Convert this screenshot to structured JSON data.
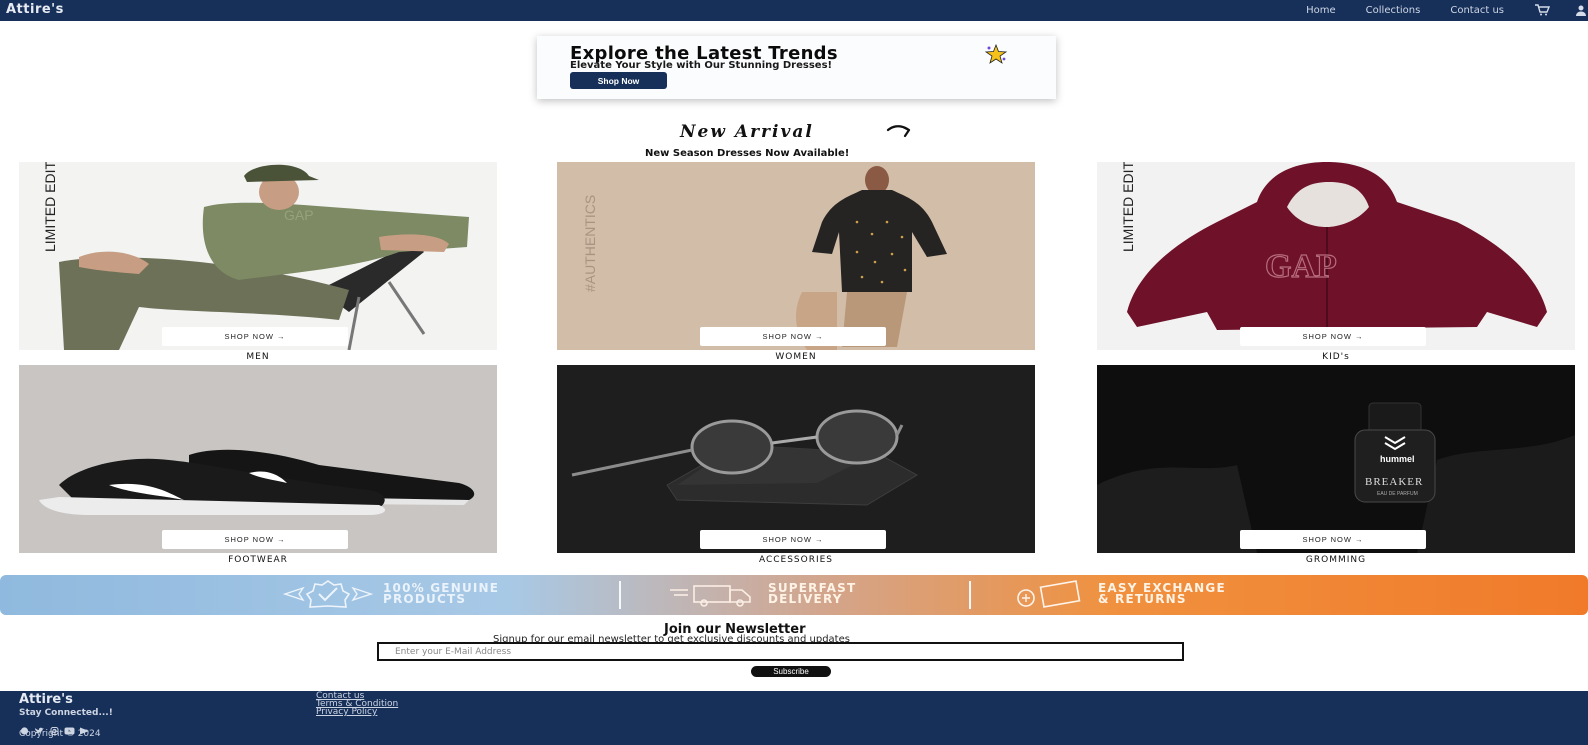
{
  "nav": {
    "brand": "Attire's",
    "links": [
      "Home",
      "Collections",
      "Contact us"
    ],
    "icons": [
      "cart-icon",
      "user-icon"
    ]
  },
  "hero": {
    "title": "Explore the Latest Trends",
    "subtitle": "Elevate Your Style with Our Stunning Dresses!",
    "button": "Shop Now"
  },
  "new_arrival": {
    "title": "New Arrival",
    "subtitle": "New Season Dresses Now Available!"
  },
  "categories": [
    {
      "label": "MEN",
      "button": "SHOP NOW →",
      "side_text": "LIMITED EDITION",
      "logo": "GAP"
    },
    {
      "label": "WOMEN",
      "button": "SHOP NOW →",
      "side_text": "#AUTHENTICS"
    },
    {
      "label": "KID's",
      "button": "SHOP NOW →",
      "side_text": "LIMITED EDITION",
      "logo": "GAP"
    },
    {
      "label": "FOOTWEAR",
      "button": "SHOP NOW →"
    },
    {
      "label": "ACCESSORIES",
      "button": "SHOP NOW →"
    },
    {
      "label": "GROMMING",
      "button": "SHOP NOW →",
      "brand": "hummel",
      "product": "BREAKER",
      "product_sub": "EAU DE PARFUM"
    }
  ],
  "banner": {
    "items": [
      {
        "line1": "100% GENUINE",
        "line2": "PRODUCTS"
      },
      {
        "line1": "SUPERFAST",
        "line2": "DELIVERY"
      },
      {
        "line1": "EASY EXCHANGE",
        "line2": "& RETURNS"
      }
    ]
  },
  "newsletter": {
    "title": "Join our Newsletter",
    "subtitle": "Signup for our email newsletter to get exclusive discounts and updates",
    "placeholder": "Enter your E-Mail Address",
    "button": "Subscribe"
  },
  "footer": {
    "brand": "Attire's",
    "tagline": "Stay Connected...!",
    "copyright": "Copyright © 2024",
    "links": [
      "Contact us",
      "Terms & Condition",
      "Privacy Policy"
    ],
    "social_icons": [
      "facebook-icon",
      "twitter-icon",
      "instagram-icon",
      "youtube-icon",
      "play-icon"
    ]
  },
  "colors": {
    "navy": "#17305a",
    "banner_blue": "#8fb9de",
    "banner_orange": "#f07a2a"
  }
}
